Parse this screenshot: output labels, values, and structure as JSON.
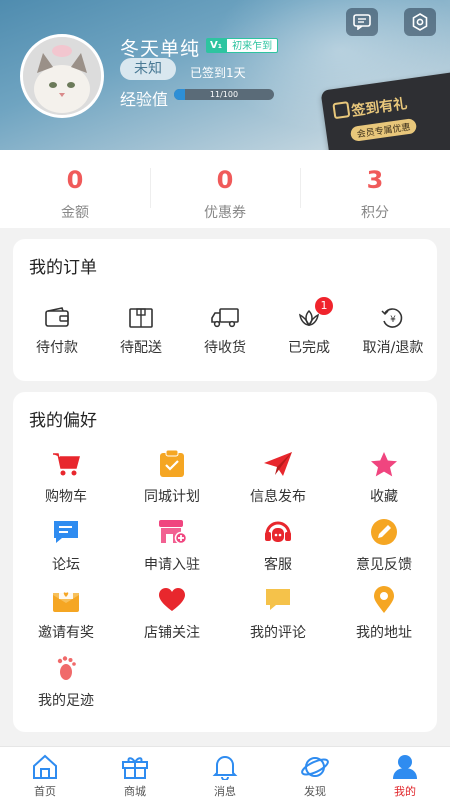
{
  "header": {
    "username": "冬天单纯",
    "level_badge": "V₁",
    "level_title": "初来乍到",
    "status_chip": "未知",
    "signed_text": "已签到1天",
    "exp_label": "经验值",
    "exp_text": "11/100",
    "exp_fraction": 0.11,
    "signcard_title": "签到有礼",
    "signcard_sub": "会员专属优惠"
  },
  "stats": [
    {
      "value": "0",
      "label": "金额"
    },
    {
      "value": "0",
      "label": "优惠券"
    },
    {
      "value": "3",
      "label": "积分"
    }
  ],
  "orders": {
    "title": "我的订单",
    "items": [
      {
        "label": "待付款",
        "icon": "wallet-icon"
      },
      {
        "label": "待配送",
        "icon": "package-icon"
      },
      {
        "label": "待收货",
        "icon": "truck-icon"
      },
      {
        "label": "已完成",
        "icon": "flower-icon",
        "badge": "1"
      },
      {
        "label": "取消/退款",
        "icon": "refund-icon"
      }
    ]
  },
  "preferences": {
    "title": "我的偏好",
    "items": [
      {
        "label": "购物车",
        "icon": "cart-icon",
        "color": "#e8272d"
      },
      {
        "label": "同城计划",
        "icon": "clipboard-icon",
        "color": "#f5a623"
      },
      {
        "label": "信息发布",
        "icon": "paper-plane-icon",
        "color": "#e8272d"
      },
      {
        "label": "收藏",
        "icon": "star-icon",
        "color": "#f0457f"
      },
      {
        "label": "论坛",
        "icon": "chat-icon",
        "color": "#2f8cf0"
      },
      {
        "label": "申请入驻",
        "icon": "shop-icon",
        "color": "#f0457f"
      },
      {
        "label": "客服",
        "icon": "headset-icon",
        "color": "#e8272d"
      },
      {
        "label": "意见反馈",
        "icon": "pencil-icon",
        "color": "#f5a623"
      },
      {
        "label": "邀请有奖",
        "icon": "envelope-icon",
        "color": "#f5a623"
      },
      {
        "label": "店铺关注",
        "icon": "heart-icon",
        "color": "#e8272d"
      },
      {
        "label": "我的评论",
        "icon": "comment-icon",
        "color": "#f5c24a"
      },
      {
        "label": "我的地址",
        "icon": "location-icon",
        "color": "#f5a623"
      },
      {
        "label": "我的足迹",
        "icon": "footprint-icon",
        "color": "#f06a6a"
      }
    ]
  },
  "tabbar": {
    "items": [
      {
        "label": "首页",
        "icon": "home-icon"
      },
      {
        "label": "商城",
        "icon": "gift-icon"
      },
      {
        "label": "消息",
        "icon": "bell-icon"
      },
      {
        "label": "发现",
        "icon": "planet-icon"
      },
      {
        "label": "我的",
        "icon": "user-icon",
        "active": true
      }
    ],
    "accent": "#2f8cf0",
    "active_color": "#e0262b"
  }
}
